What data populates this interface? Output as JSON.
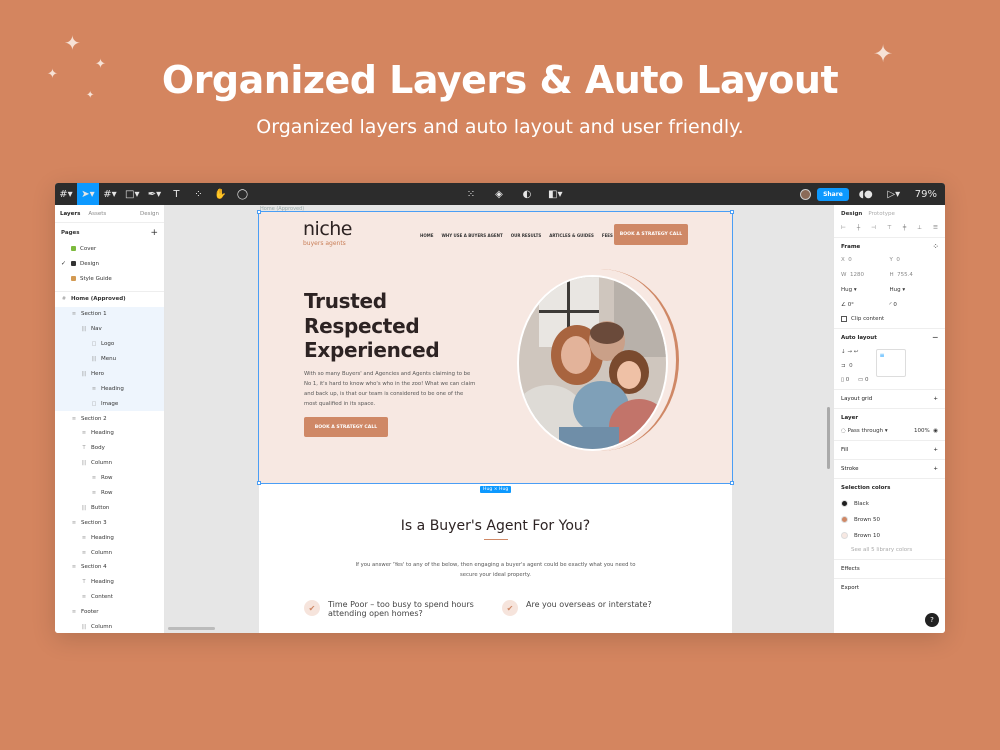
{
  "header": {
    "title": "Organized Layers & Auto Layout",
    "subtitle": "Organized layers and auto layout and user friendly."
  },
  "toolbar": {
    "share_label": "Share",
    "zoom": "79%"
  },
  "left_panel": {
    "tabs": [
      "Layers",
      "Assets",
      "Design"
    ],
    "pages_label": "Pages",
    "pages": [
      {
        "name": "Cover",
        "color": "#7cba3d",
        "current": false
      },
      {
        "name": "Design",
        "color": "#333333",
        "current": true
      },
      {
        "name": "Style Guide",
        "color": "#d39a52",
        "current": false
      }
    ],
    "layers": [
      {
        "name": "Home (Approved)",
        "depth": 0,
        "icon": "#",
        "selected": false
      },
      {
        "name": "Section 1",
        "depth": 1,
        "icon": "≡",
        "selected": true
      },
      {
        "name": "Nav",
        "depth": 2,
        "icon": "|||",
        "selected": true
      },
      {
        "name": "Logo",
        "depth": 3,
        "icon": "□",
        "selected": true
      },
      {
        "name": "Menu",
        "depth": 3,
        "icon": "|||",
        "selected": true
      },
      {
        "name": "Hero",
        "depth": 2,
        "icon": "|||",
        "selected": true
      },
      {
        "name": "Heading",
        "depth": 3,
        "icon": "≡",
        "selected": true
      },
      {
        "name": "Image",
        "depth": 3,
        "icon": "□",
        "selected": true
      },
      {
        "name": "Section 2",
        "depth": 1,
        "icon": "≡",
        "selected": false
      },
      {
        "name": "Heading",
        "depth": 2,
        "icon": "≡",
        "selected": false
      },
      {
        "name": "Body",
        "depth": 2,
        "icon": "T",
        "selected": false
      },
      {
        "name": "Column",
        "depth": 2,
        "icon": "|||",
        "selected": false
      },
      {
        "name": "Row",
        "depth": 3,
        "icon": "≡",
        "selected": false
      },
      {
        "name": "Row",
        "depth": 3,
        "icon": "≡",
        "selected": false
      },
      {
        "name": "Button",
        "depth": 2,
        "icon": "|||",
        "selected": false
      },
      {
        "name": "Section 3",
        "depth": 1,
        "icon": "≡",
        "selected": false
      },
      {
        "name": "Heading",
        "depth": 2,
        "icon": "≡",
        "selected": false
      },
      {
        "name": "Column",
        "depth": 2,
        "icon": "≡",
        "selected": false
      },
      {
        "name": "Section 4",
        "depth": 1,
        "icon": "≡",
        "selected": false
      },
      {
        "name": "Heading",
        "depth": 2,
        "icon": "T",
        "selected": false
      },
      {
        "name": "Content",
        "depth": 2,
        "icon": "≡",
        "selected": false
      },
      {
        "name": "Footer",
        "depth": 1,
        "icon": "≡",
        "selected": false
      },
      {
        "name": "Column",
        "depth": 2,
        "icon": "|||",
        "selected": false
      }
    ]
  },
  "canvas": {
    "frame_label": "Home (Approved)",
    "hug_badge": "Hug × Hug",
    "site": {
      "logo": "niche",
      "logo_sub": "buyers agents",
      "menu": [
        "HOME",
        "WHY USE A BUYERS AGENT",
        "OUR RESULTS",
        "ARTICLES & GUIDES",
        "FEES"
      ],
      "cta": "BOOK A STRATEGY CALL",
      "hero_lines": [
        "Trusted",
        "Respected",
        "Experienced"
      ],
      "hero_body": "With so many Buyers' and Agencies and Agents claiming to be No 1, it's hard to know who's who in the zoo! What we can claim and back up, is that our team is considered to be one of the most qualified in its space.",
      "hero_button": "BOOK A STRATEGY CALL",
      "section2_title": "Is a Buyer's Agent For You?",
      "section2_body": "If you answer 'Yes' to any of the below, then engaging a buyer's agent could be exactly what you need to secure your ideal property.",
      "features": [
        {
          "line1": "Time Poor – too busy to spend hours",
          "line2": "attending open homes?"
        },
        {
          "line1": "Are you overseas or interstate?",
          "line2": ""
        }
      ]
    }
  },
  "right_panel": {
    "tabs": [
      "Design",
      "Prototype"
    ],
    "frame_label": "Frame",
    "x_label": "X",
    "x_value": "0",
    "y_label": "Y",
    "y_value": "0",
    "w_label": "W",
    "w_value": "1280",
    "h_label": "H",
    "h_value": "755.4",
    "hug_w": "Hug",
    "hug_h": "Hug",
    "rotation": "0°",
    "radius": "0",
    "clip_label": "Clip content",
    "auto_layout_label": "Auto layout",
    "gap_value": "0",
    "pad_h": "0",
    "pad_v": "0",
    "layout_grid_label": "Layout grid",
    "layer_label": "Layer",
    "blend_label": "Pass through",
    "opacity": "100%",
    "fill_label": "Fill",
    "stroke_label": "Stroke",
    "selection_colors_label": "Selection colors",
    "selection_colors": [
      {
        "name": "Black",
        "color": "#1e1e1e"
      },
      {
        "name": "Brown 50",
        "color": "#cf8866"
      },
      {
        "name": "Brown 10",
        "color": "#f7e8e2"
      }
    ],
    "library_link": "See all 5 library colors",
    "effects_label": "Effects",
    "export_label": "Export",
    "help": "?"
  }
}
